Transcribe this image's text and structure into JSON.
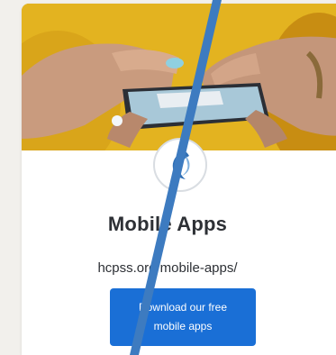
{
  "card": {
    "title": "Mobile Apps",
    "url": "hcpss.org/mobile-apps/",
    "button_label": "Download our free mobile apps"
  },
  "colors": {
    "accent": "#1a6fd6",
    "title_text": "#2d3035",
    "hero_yellow": "#e2b21a",
    "overlay_line": "#3d7bc0"
  },
  "icons": {
    "logo": "hcpss-logo-icon"
  }
}
